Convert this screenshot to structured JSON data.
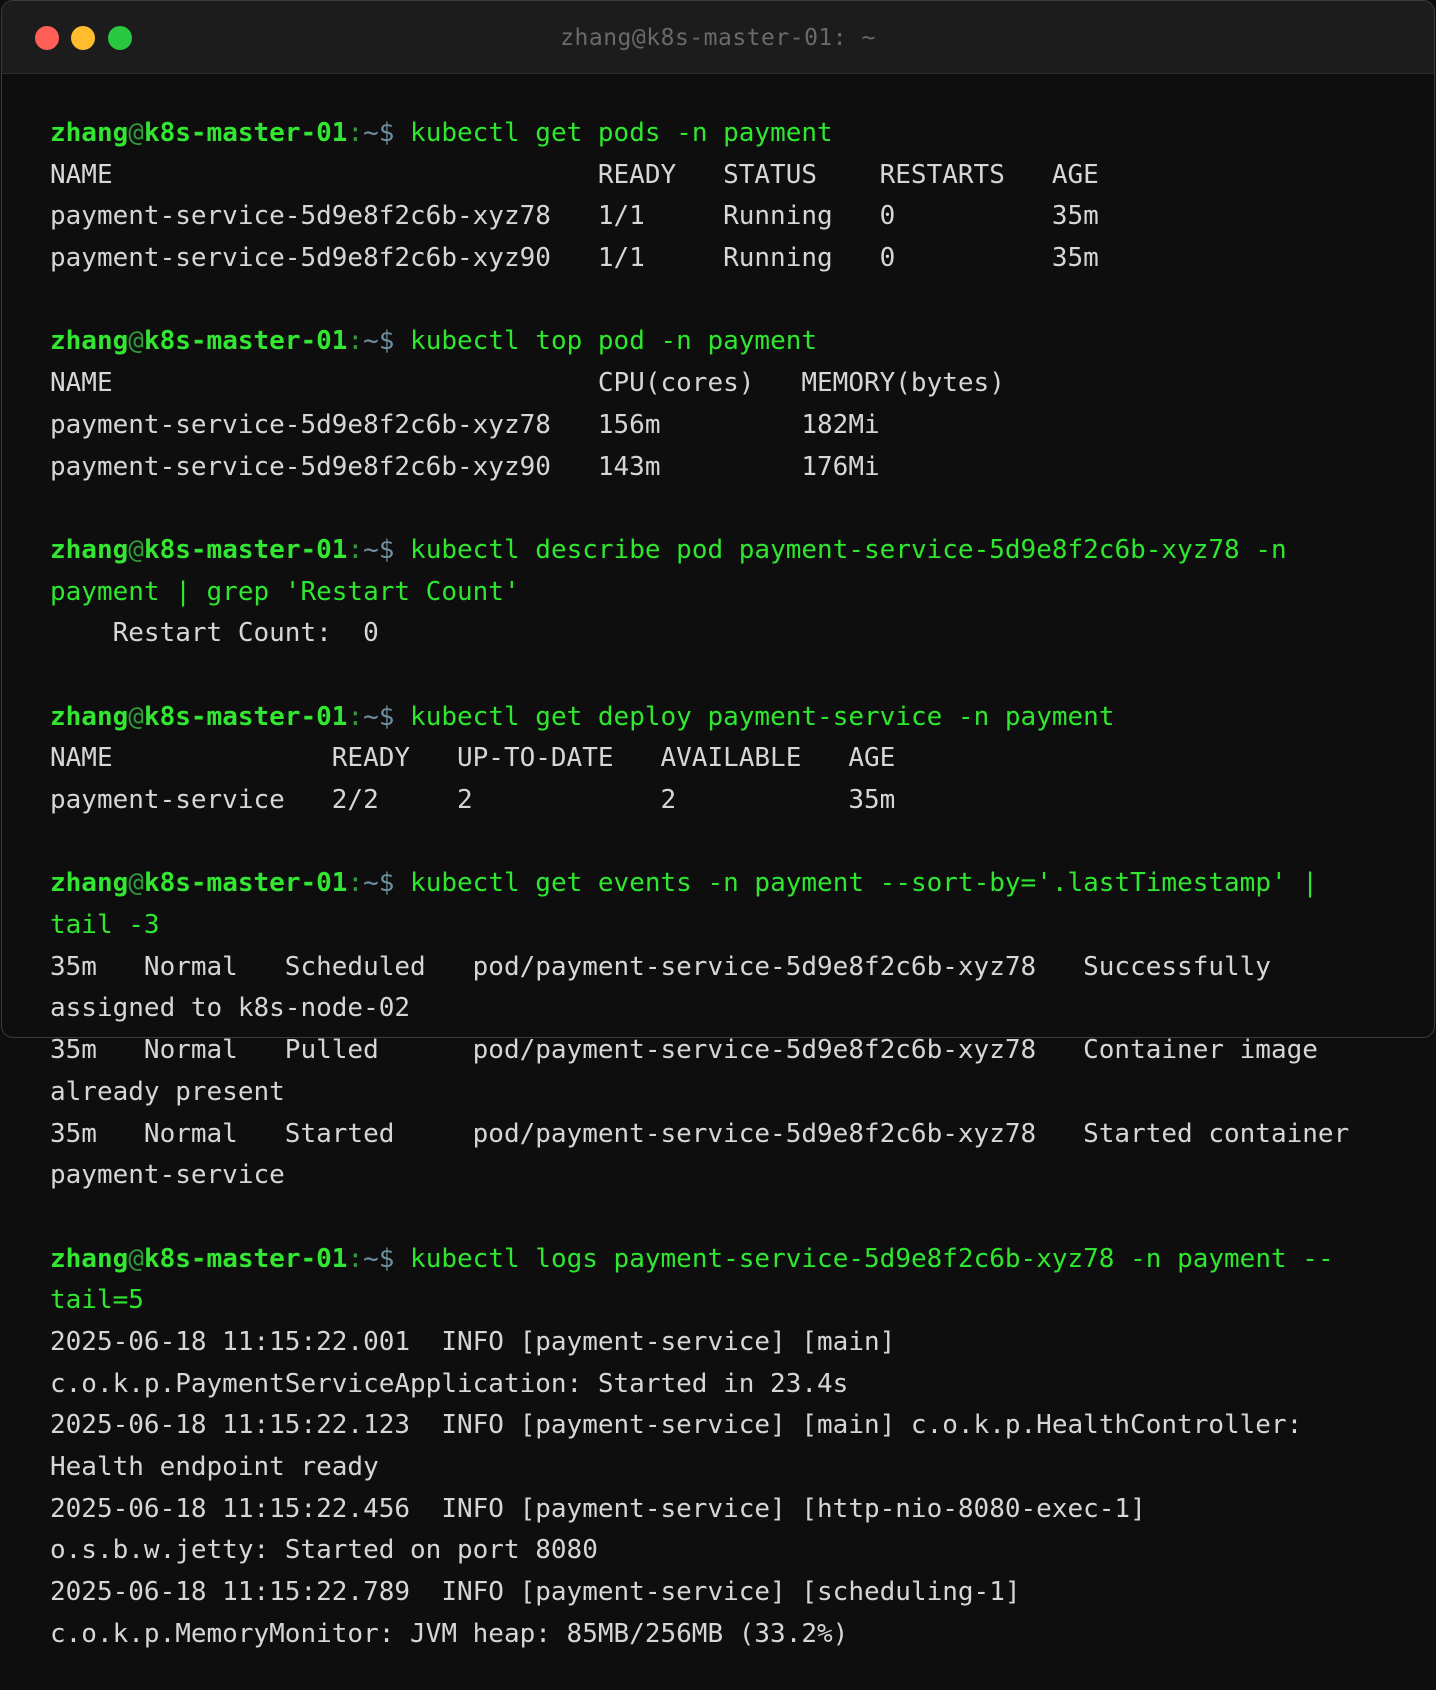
{
  "window": {
    "title": "zhang@k8s-master-01: ~"
  },
  "prompt": {
    "user": "zhang",
    "at": "@",
    "host": "k8s-master-01",
    "colon": ":",
    "path": "~$"
  },
  "blocks": [
    {
      "command": [
        " kubectl get pods -n payment"
      ],
      "output": [
        "NAME                               READY   STATUS    RESTARTS   AGE",
        "payment-service-5d9e8f2c6b-xyz78   1/1     Running   0          35m",
        "payment-service-5d9e8f2c6b-xyz90   1/1     Running   0          35m"
      ]
    },
    {
      "command": [
        " kubectl top pod -n payment"
      ],
      "output": [
        "NAME                               CPU(cores)   MEMORY(bytes)",
        "payment-service-5d9e8f2c6b-xyz78   156m         182Mi",
        "payment-service-5d9e8f2c6b-xyz90   143m         176Mi"
      ]
    },
    {
      "command": [
        " kubectl describe pod payment-service-5d9e8f2c6b-xyz78 -n",
        "payment | grep 'Restart Count'"
      ],
      "output": [
        "    Restart Count:  0"
      ]
    },
    {
      "command": [
        " kubectl get deploy payment-service -n payment"
      ],
      "output": [
        "NAME              READY   UP-TO-DATE   AVAILABLE   AGE",
        "payment-service   2/2     2            2           35m"
      ]
    },
    {
      "command": [
        " kubectl get events -n payment --sort-by='.lastTimestamp' |",
        "tail -3"
      ],
      "output": [
        "35m   Normal   Scheduled   pod/payment-service-5d9e8f2c6b-xyz78   Successfully",
        "assigned to k8s-node-02",
        "35m   Normal   Pulled      pod/payment-service-5d9e8f2c6b-xyz78   Container image",
        "already present",
        "35m   Normal   Started     pod/payment-service-5d9e8f2c6b-xyz78   Started container",
        "payment-service"
      ]
    },
    {
      "command": [
        " kubectl logs payment-service-5d9e8f2c6b-xyz78 -n payment --",
        "tail=5"
      ],
      "output": [
        "2025-06-18 11:15:22.001  INFO [payment-service] [main]",
        "c.o.k.p.PaymentServiceApplication: Started in 23.4s",
        "2025-06-18 11:15:22.123  INFO [payment-service] [main] c.o.k.p.HealthController:",
        "Health endpoint ready",
        "2025-06-18 11:15:22.456  INFO [payment-service] [http-nio-8080-exec-1]",
        "o.s.b.w.jetty: Started on port 8080",
        "2025-06-18 11:15:22.789  INFO [payment-service] [scheduling-1]",
        "c.o.k.p.MemoryMonitor: JVM heap: 85MB/256MB (33.2%)"
      ]
    }
  ]
}
